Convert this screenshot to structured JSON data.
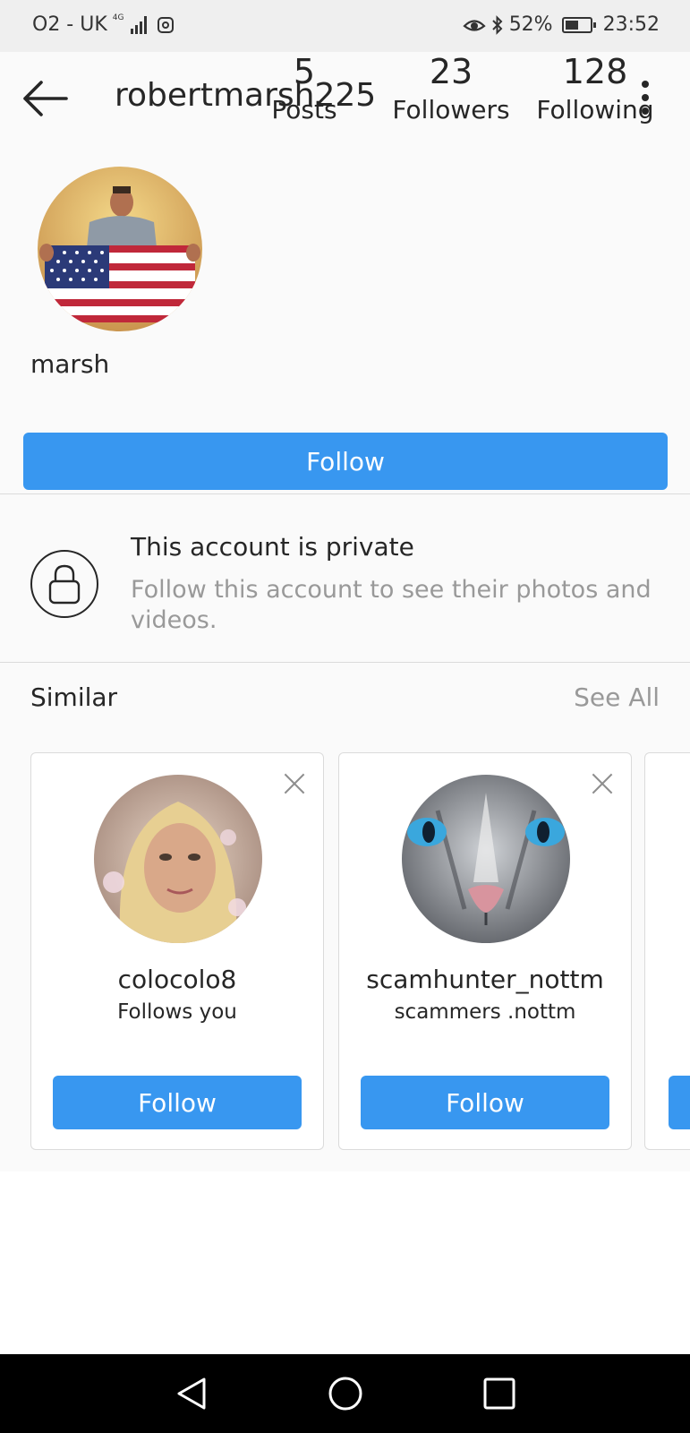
{
  "status_bar": {
    "carrier": "O2 - UK",
    "network": "4G",
    "battery": "52%",
    "battery_level": 0.52,
    "time": "23:52"
  },
  "header": {
    "username": "robertmarsh225",
    "back_icon": "back-arrow-icon",
    "menu_icon": "more-vertical-icon"
  },
  "profile": {
    "name": "marsh",
    "stats": [
      {
        "value": "5",
        "label": "Posts"
      },
      {
        "value": "23",
        "label": "Followers"
      },
      {
        "value": "128",
        "label": "Following"
      }
    ],
    "follow_label": "Follow"
  },
  "private_notice": {
    "title": "This account is private",
    "description": "Follow this account to see their photos and videos.",
    "icon": "lock-icon"
  },
  "similar": {
    "title": "Similar",
    "see_all": "See All",
    "accounts": [
      {
        "username": "colocolo8",
        "subtitle": "Follows you",
        "follow_label": "Follow"
      },
      {
        "username": "scamhunter_nottm",
        "subtitle": "scammers .nottm",
        "follow_label": "Follow"
      }
    ]
  },
  "nav": {
    "back": "back-triangle-icon",
    "home": "home-circle-icon",
    "recents": "recents-square-icon"
  },
  "colors": {
    "accent": "#3897f0",
    "background": "#fafafa",
    "text": "#262626",
    "muted": "#999999"
  }
}
